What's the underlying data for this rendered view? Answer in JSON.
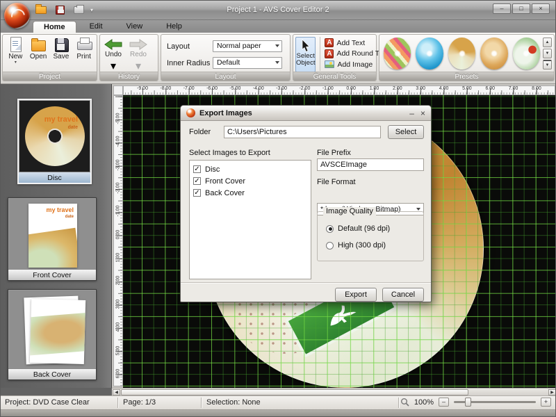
{
  "window": {
    "title": "Project 1 - AVS Cover Editor 2"
  },
  "menu": {
    "tabs": [
      {
        "label": "Home",
        "active": true
      },
      {
        "label": "Edit",
        "active": false
      },
      {
        "label": "View",
        "active": false
      },
      {
        "label": "Help",
        "active": false
      }
    ]
  },
  "ribbon": {
    "project": {
      "label": "Project",
      "buttons": [
        "New",
        "Open",
        "Save",
        "Print"
      ]
    },
    "history": {
      "label": "History",
      "undo": "Undo",
      "redo": "Redo"
    },
    "layout": {
      "label": "Layout",
      "rows": [
        {
          "label": "Layout",
          "value": "Normal paper"
        },
        {
          "label": "Inner Radius",
          "value": "Default"
        }
      ]
    },
    "tools": {
      "label": "General Tools",
      "select_object": "Select Object",
      "items": [
        "Add Text",
        "Add Round Text",
        "Add Image"
      ]
    },
    "presets": {
      "label": "Presets",
      "items": [
        "preset-disc-1",
        "preset-disc-2",
        "preset-disc-3",
        "preset-disc-4",
        "preset-disc-5"
      ]
    }
  },
  "sidebar": {
    "thumbnails": [
      {
        "label": "Disc",
        "selected": true
      },
      {
        "label": "Front Cover",
        "selected": false
      },
      {
        "label": "Back Cover",
        "selected": false
      }
    ],
    "artwork": {
      "title": "my travel",
      "subtitle": "date"
    }
  },
  "canvas": {
    "h_ruler": [
      "-9.00",
      "-8.00",
      "-7.00",
      "-6.00",
      "-5.00",
      "-4.00",
      "-3.00",
      "-2.00",
      "-1.00",
      "0.00",
      "1.00",
      "2.00",
      "3.00",
      "4.00",
      "5.00",
      "6.00",
      "7.00",
      "8.00"
    ],
    "v_ruler": [
      "-5.00",
      "-4.00",
      "-3.00",
      "-2.00",
      "-1.00",
      "0.00",
      "1.00",
      "2.00",
      "3.00",
      "4.00",
      "5.00",
      "6.00"
    ],
    "grid_color": "#46a52d",
    "background": "#0a0b09"
  },
  "dialog": {
    "title": "Export Images",
    "folder_label": "Folder",
    "folder_value": "C:\\Users\\Pictures",
    "select_button": "Select",
    "list_label": "Select Images to Export",
    "items": [
      {
        "label": "Disc",
        "checked": true
      },
      {
        "label": "Front Cover",
        "checked": true
      },
      {
        "label": "Back Cover",
        "checked": true
      }
    ],
    "file_prefix_label": "File Prefix",
    "file_prefix_value": "AVSCEImage",
    "file_format_label": "File Format",
    "file_format_value": "*.bmp (Windows Bitmap)",
    "quality": {
      "label": "Image Quality",
      "options": [
        {
          "label": "Default (96 dpi)",
          "selected": true
        },
        {
          "label": "High (300 dpi)",
          "selected": false
        }
      ]
    },
    "export_button": "Export",
    "cancel_button": "Cancel"
  },
  "statusbar": {
    "project": "Project: DVD Case Clear",
    "page": "Page: 1/3",
    "selection": "Selection: None",
    "zoom": "100%"
  }
}
